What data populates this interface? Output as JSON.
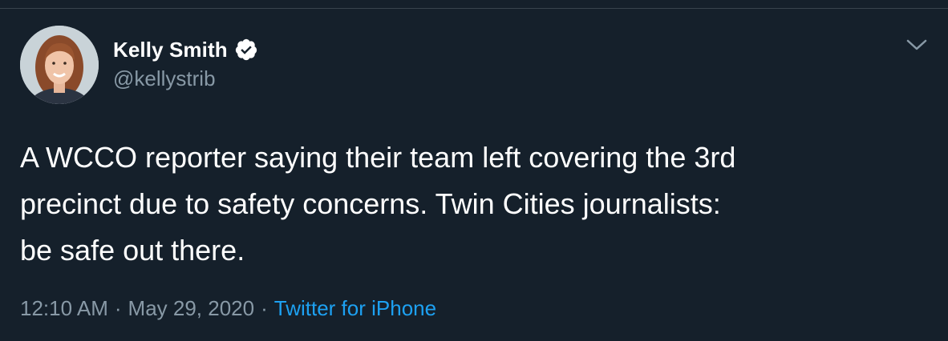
{
  "tweet": {
    "author": {
      "display_name": "Kelly Smith",
      "handle": "@kellystrib",
      "verified": true
    },
    "text_lines": [
      "A WCCO reporter saying their team left covering the 3rd",
      "precinct due to safety concerns. Twin Cities journalists:",
      "be safe out there."
    ],
    "time": "12:10 AM",
    "separator": "·",
    "date": "May 29, 2020",
    "source": "Twitter for iPhone"
  },
  "colors": {
    "background": "#15202b",
    "text": "#ffffff",
    "secondary": "#8899a6",
    "link": "#1da1f2"
  },
  "icons": {
    "verified": "verified-badge-icon",
    "menu": "chevron-down-icon"
  }
}
